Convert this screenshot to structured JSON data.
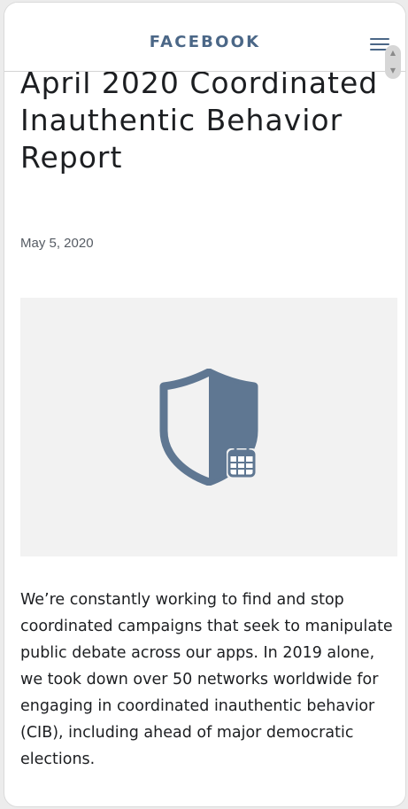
{
  "header": {
    "brand": "FACEBOOK",
    "menu_icon": "hamburger-menu-icon"
  },
  "article": {
    "title": "April 2020 Coordinated Inauthentic Behavior Report",
    "date": "May 5, 2020",
    "hero_icon": "shield-calendar-icon",
    "body": "We’re constantly working to find and stop coordinated campaigns that seek to manipulate public debate across our apps. In 2019 alone, we took down over 50 networks worldwide for engaging in coordinated inauthentic behavior (CIB), including ahead of major democratic elections."
  },
  "colors": {
    "brand": "#4b6787",
    "icon": "#5f7792",
    "text": "#1c1e21",
    "hero_bg": "#f2f2f2"
  }
}
